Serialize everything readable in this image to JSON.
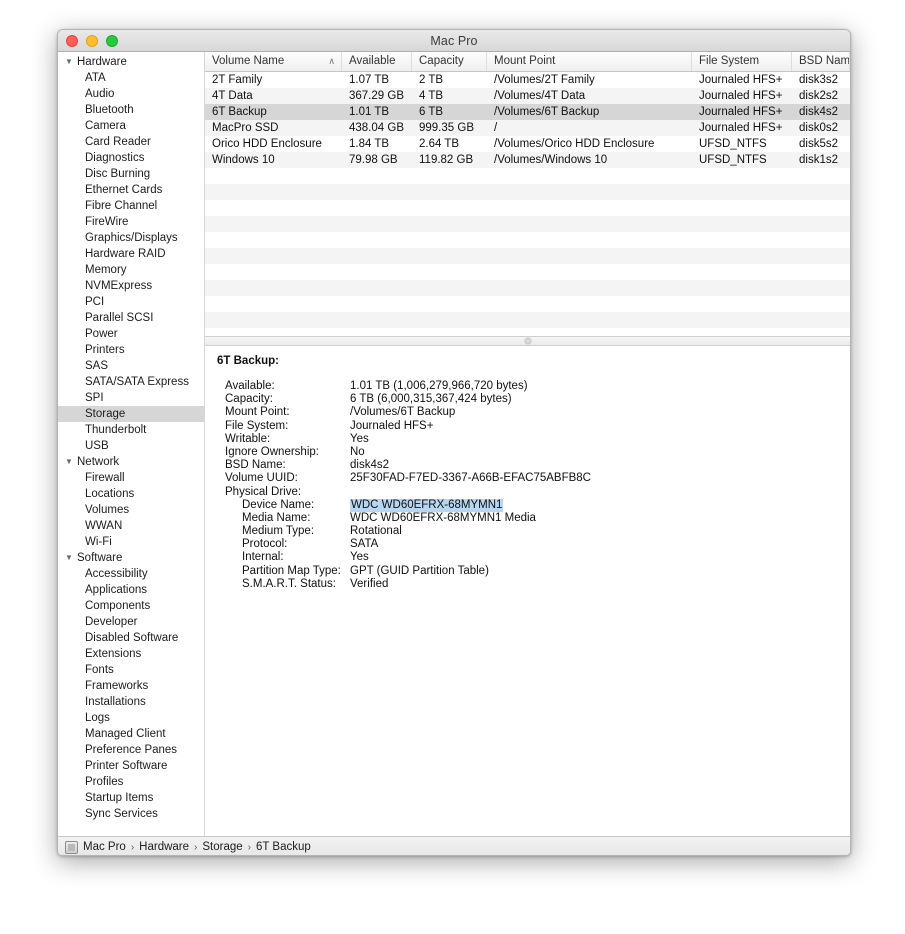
{
  "window": {
    "title": "Mac Pro",
    "controls": {
      "close": "close-button",
      "minimize": "minimize-button",
      "zoom": "zoom-button"
    }
  },
  "sidebar": {
    "items": [
      {
        "label": "Hardware",
        "type": "group",
        "expanded": true
      },
      {
        "label": "ATA",
        "type": "child"
      },
      {
        "label": "Audio",
        "type": "child"
      },
      {
        "label": "Bluetooth",
        "type": "child"
      },
      {
        "label": "Camera",
        "type": "child"
      },
      {
        "label": "Card Reader",
        "type": "child"
      },
      {
        "label": "Diagnostics",
        "type": "child"
      },
      {
        "label": "Disc Burning",
        "type": "child"
      },
      {
        "label": "Ethernet Cards",
        "type": "child"
      },
      {
        "label": "Fibre Channel",
        "type": "child"
      },
      {
        "label": "FireWire",
        "type": "child"
      },
      {
        "label": "Graphics/Displays",
        "type": "child"
      },
      {
        "label": "Hardware RAID",
        "type": "child"
      },
      {
        "label": "Memory",
        "type": "child"
      },
      {
        "label": "NVMExpress",
        "type": "child"
      },
      {
        "label": "PCI",
        "type": "child"
      },
      {
        "label": "Parallel SCSI",
        "type": "child"
      },
      {
        "label": "Power",
        "type": "child"
      },
      {
        "label": "Printers",
        "type": "child"
      },
      {
        "label": "SAS",
        "type": "child"
      },
      {
        "label": "SATA/SATA Express",
        "type": "child"
      },
      {
        "label": "SPI",
        "type": "child"
      },
      {
        "label": "Storage",
        "type": "child",
        "selected": true
      },
      {
        "label": "Thunderbolt",
        "type": "child"
      },
      {
        "label": "USB",
        "type": "child"
      },
      {
        "label": "Network",
        "type": "group",
        "expanded": true
      },
      {
        "label": "Firewall",
        "type": "child"
      },
      {
        "label": "Locations",
        "type": "child"
      },
      {
        "label": "Volumes",
        "type": "child"
      },
      {
        "label": "WWAN",
        "type": "child"
      },
      {
        "label": "Wi-Fi",
        "type": "child"
      },
      {
        "label": "Software",
        "type": "group",
        "expanded": true
      },
      {
        "label": "Accessibility",
        "type": "child"
      },
      {
        "label": "Applications",
        "type": "child"
      },
      {
        "label": "Components",
        "type": "child"
      },
      {
        "label": "Developer",
        "type": "child"
      },
      {
        "label": "Disabled Software",
        "type": "child"
      },
      {
        "label": "Extensions",
        "type": "child"
      },
      {
        "label": "Fonts",
        "type": "child"
      },
      {
        "label": "Frameworks",
        "type": "child"
      },
      {
        "label": "Installations",
        "type": "child"
      },
      {
        "label": "Logs",
        "type": "child"
      },
      {
        "label": "Managed Client",
        "type": "child"
      },
      {
        "label": "Preference Panes",
        "type": "child"
      },
      {
        "label": "Printer Software",
        "type": "child"
      },
      {
        "label": "Profiles",
        "type": "child"
      },
      {
        "label": "Startup Items",
        "type": "child"
      },
      {
        "label": "Sync Services",
        "type": "child"
      }
    ],
    "disclosure_glyph": "▼"
  },
  "table": {
    "columns": [
      "Volume Name",
      "Available",
      "Capacity",
      "Mount Point",
      "File System",
      "BSD Name"
    ],
    "sort_column": "Volume Name",
    "sort_glyph": "∧",
    "rows": [
      {
        "cells": [
          "2T Family",
          "1.07 TB",
          "2 TB",
          "/Volumes/2T Family",
          "Journaled HFS+",
          "disk3s2"
        ],
        "selected": false
      },
      {
        "cells": [
          "4T Data",
          "367.29 GB",
          "4 TB",
          "/Volumes/4T Data",
          "Journaled HFS+",
          "disk2s2"
        ],
        "selected": false
      },
      {
        "cells": [
          "6T Backup",
          "1.01 TB",
          "6 TB",
          "/Volumes/6T Backup",
          "Journaled HFS+",
          "disk4s2"
        ],
        "selected": true
      },
      {
        "cells": [
          "MacPro SSD",
          "438.04 GB",
          "999.35 GB",
          "/",
          "Journaled HFS+",
          "disk0s2"
        ],
        "selected": false
      },
      {
        "cells": [
          "Orico HDD Enclosure",
          "1.84 TB",
          "2.64 TB",
          "/Volumes/Orico HDD Enclosure",
          "UFSD_NTFS",
          "disk5s2"
        ],
        "selected": false
      },
      {
        "cells": [
          "Windows 10",
          "79.98 GB",
          "119.82 GB",
          "/Volumes/Windows 10",
          "UFSD_NTFS",
          "disk1s2"
        ],
        "selected": false
      }
    ],
    "empty_row_count": 10
  },
  "detail": {
    "title": "6T Backup:",
    "fields": [
      {
        "label": "Available:",
        "value": "1.01 TB (1,006,279,966,720 bytes)",
        "indent": false,
        "highlight": false
      },
      {
        "label": "Capacity:",
        "value": "6 TB (6,000,315,367,424 bytes)",
        "indent": false,
        "highlight": false
      },
      {
        "label": "Mount Point:",
        "value": "/Volumes/6T Backup",
        "indent": false,
        "highlight": false
      },
      {
        "label": "File System:",
        "value": "Journaled HFS+",
        "indent": false,
        "highlight": false
      },
      {
        "label": "Writable:",
        "value": "Yes",
        "indent": false,
        "highlight": false
      },
      {
        "label": "Ignore Ownership:",
        "value": "No",
        "indent": false,
        "highlight": false
      },
      {
        "label": "BSD Name:",
        "value": "disk4s2",
        "indent": false,
        "highlight": false
      },
      {
        "label": "Volume UUID:",
        "value": "25F30FAD-F7ED-3367-A66B-EFAC75ABFB8C",
        "indent": false,
        "highlight": false
      },
      {
        "label": "Physical Drive:",
        "value": "",
        "indent": false,
        "highlight": false
      },
      {
        "label": "Device Name:",
        "value": "WDC WD60EFRX-68MYMN1",
        "indent": true,
        "highlight": true
      },
      {
        "label": "Media Name:",
        "value": "WDC WD60EFRX-68MYMN1 Media",
        "indent": true,
        "highlight": false
      },
      {
        "label": "Medium Type:",
        "value": "Rotational",
        "indent": true,
        "highlight": false
      },
      {
        "label": "Protocol:",
        "value": "SATA",
        "indent": true,
        "highlight": false
      },
      {
        "label": "Internal:",
        "value": "Yes",
        "indent": true,
        "highlight": false
      },
      {
        "label": "Partition Map Type:",
        "value": "GPT (GUID Partition Table)",
        "indent": true,
        "highlight": false
      },
      {
        "label": "S.M.A.R.T. Status:",
        "value": "Verified",
        "indent": true,
        "highlight": false
      }
    ]
  },
  "breadcrumb": {
    "separator": "›",
    "items": [
      "Mac Pro",
      "Hardware",
      "Storage",
      "6T Backup"
    ]
  },
  "colors": {
    "selection_row": "#d6d6d6",
    "text_highlight": "#b6d6f2",
    "alt_row": "#f4f4f4"
  }
}
